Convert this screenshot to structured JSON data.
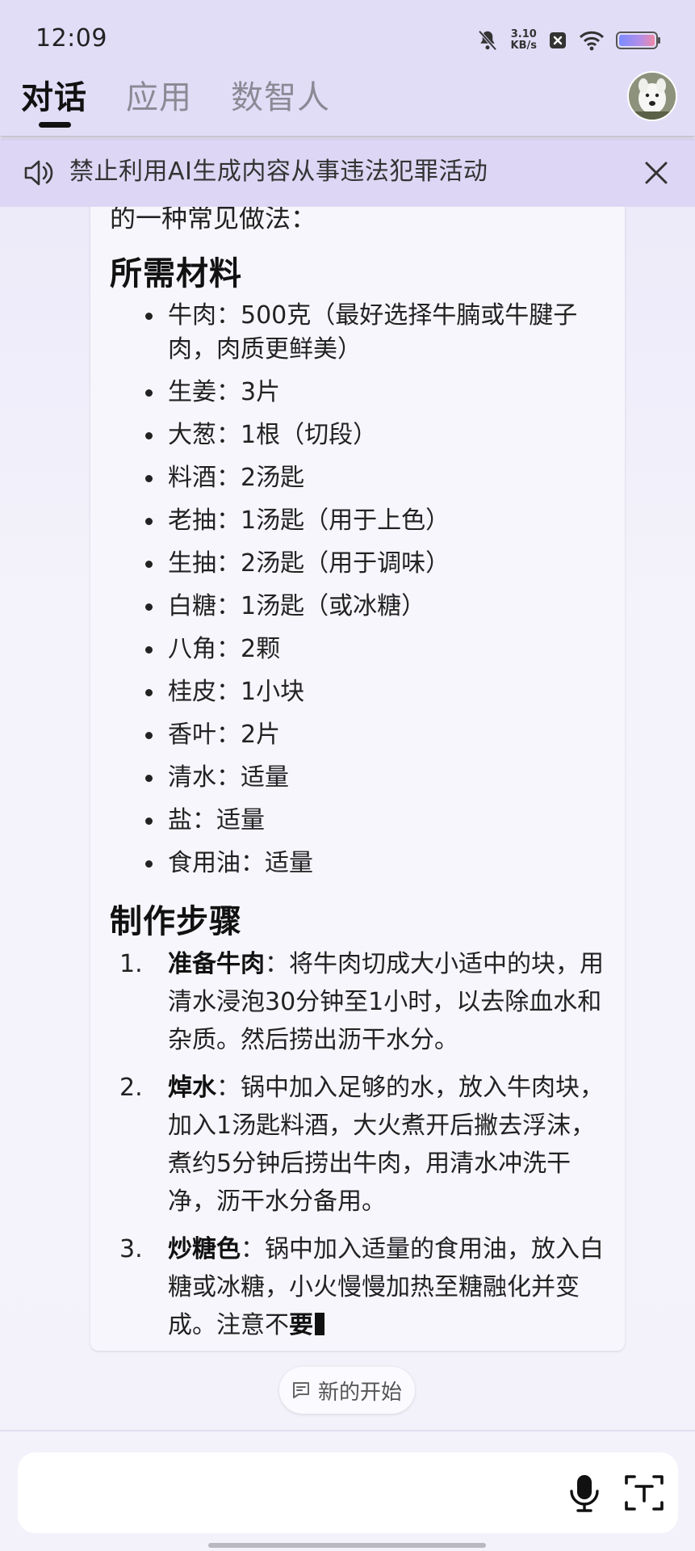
{
  "status_bar": {
    "time": "12:09",
    "net_speed_value": "3.10",
    "net_speed_unit": "KB/s",
    "icons": [
      "bell-muted-icon",
      "close-box-icon",
      "wifi-icon",
      "battery-icon"
    ]
  },
  "nav": {
    "tabs": [
      {
        "label": "对话",
        "active": true
      },
      {
        "label": "应用",
        "active": false
      },
      {
        "label": "数智人",
        "active": false
      }
    ]
  },
  "notice": {
    "text": "禁止利用AI生成内容从事违法犯罪活动"
  },
  "message": {
    "intro": "的一种常见做法：",
    "ingredients_heading": "所需材料",
    "ingredients": [
      "牛肉：500克（最好选择牛腩或牛腱子肉，肉质更鲜美）",
      "生姜：3片",
      "大葱：1根（切段）",
      "料酒：2汤匙",
      "老抽：1汤匙（用于上色）",
      "生抽：2汤匙（用于调味）",
      "白糖：1汤匙（或冰糖）",
      "八角：2颗",
      "桂皮：1小块",
      "香叶：2片",
      "清水：适量",
      "盐：适量",
      "食用油：适量"
    ],
    "steps_heading": "制作步骤",
    "steps": [
      {
        "num": "1.",
        "title": "准备牛肉",
        "text": "：将牛肉切成大小适中的块，用清水浸泡30分钟至1小时，以去除血水和杂质。然后捞出沥干水分。"
      },
      {
        "num": "2.",
        "title": "焯水",
        "text": "：锅中加入足够的水，放入牛肉块，加入1汤匙料酒，大火煮开后撇去浮沫，煮约5分钟后捞出牛肉，用清水冲洗干净，沥干水分备用。"
      },
      {
        "num": "3.",
        "title": "炒糖色",
        "text": "：锅中加入适量的食用油，放入白糖或冰糖，小火慢慢加热至糖融化并变成。注意不",
        "tail_bold": "要"
      }
    ]
  },
  "new_start_label": "新的开始",
  "input": {
    "placeholder": ""
  }
}
